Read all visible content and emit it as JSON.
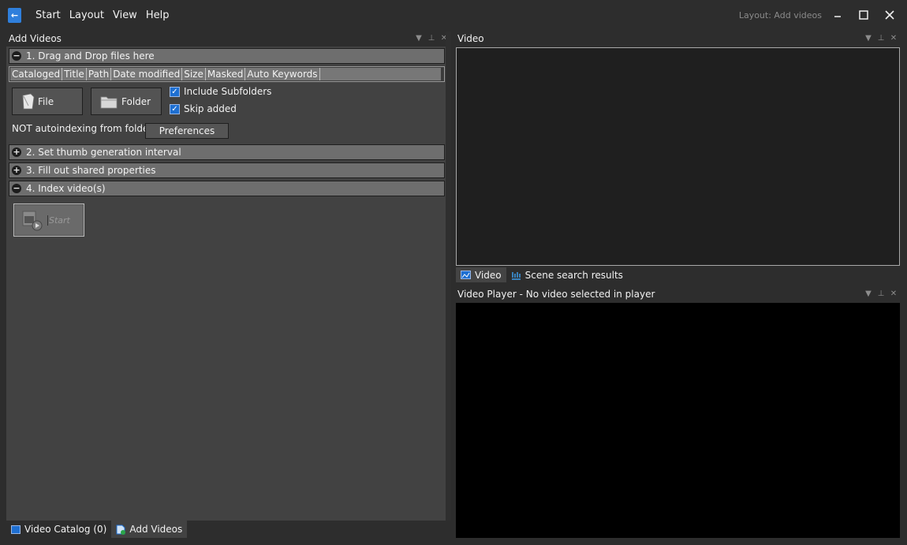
{
  "menu": [
    "Start",
    "Layout",
    "View",
    "Help"
  ],
  "layout_label": "Layout: Add videos",
  "left_panel": {
    "title": "Add Videos",
    "sections": [
      {
        "label": "1. Drag and Drop files here",
        "state": "expanded"
      },
      {
        "label": "2. Set thumb generation interval",
        "state": "collapsed"
      },
      {
        "label": "3. Fill out shared properties",
        "state": "collapsed"
      },
      {
        "label": "4. Index video(s)",
        "state": "expanded"
      }
    ],
    "columns": [
      "Cataloged",
      "Title",
      "Path",
      "Date modified",
      "Size",
      "Masked",
      "Auto Keywords"
    ],
    "file_button": "File",
    "folder_button": "Folder",
    "include_subfolders": "Include Subfolders",
    "skip_added": "Skip added",
    "autoindex_text": "NOT autoindexing from folder",
    "preferences_button": "Preferences",
    "start_button": "Start"
  },
  "bottom_tabs": [
    "Video Catalog (0)",
    "Add Videos"
  ],
  "video_panel": {
    "title": "Video",
    "tabs": [
      "Video",
      "Scene search results"
    ]
  },
  "player_panel": {
    "title": "Video Player - No video selected in player"
  },
  "icons": {
    "app": "back-arrow-icon",
    "minimize": "minimize-icon",
    "maximize": "maximize-icon",
    "close": "close-icon"
  },
  "colors": {
    "accent": "#1e6fd2",
    "panel_bg": "#424242",
    "section_bar": "#6e6e6e"
  }
}
